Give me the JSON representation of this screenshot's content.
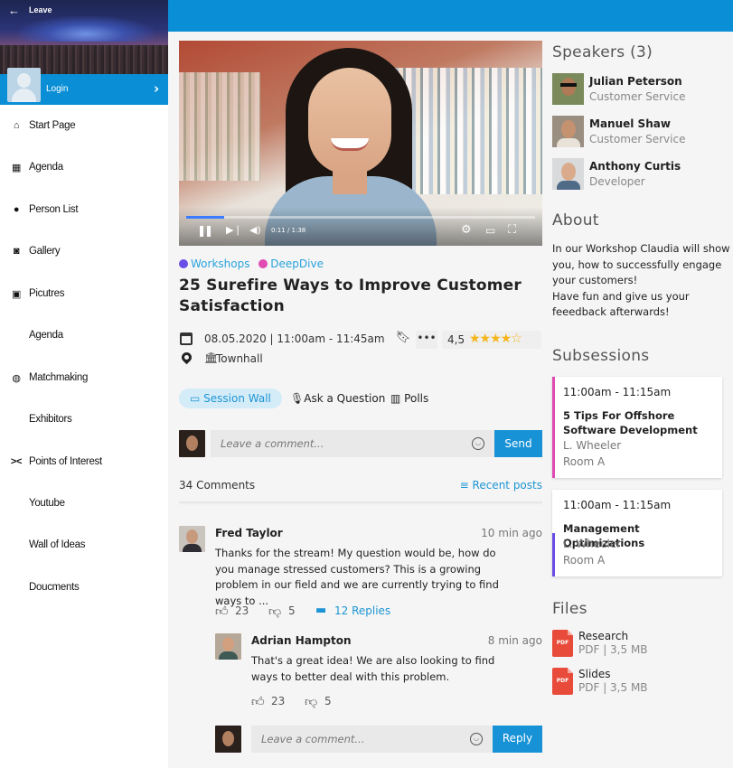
{
  "header": {
    "back_icon": "arrow-left-icon",
    "leave_label": "Leave"
  },
  "login": {
    "label": "Login"
  },
  "sidebar": {
    "items": [
      {
        "label": "Start Page",
        "icon": "home-icon"
      },
      {
        "label": "Agenda",
        "icon": "calendar-icon"
      },
      {
        "label": "Person List",
        "icon": "person-icon"
      },
      {
        "label": "Gallery",
        "icon": "camera-icon"
      },
      {
        "label": "Picutres",
        "icon": "image-icon"
      },
      {
        "label": "Agenda",
        "icon": ""
      },
      {
        "label": "Matchmaking",
        "icon": "globe-icon"
      },
      {
        "label": "Exhibitors",
        "icon": ""
      },
      {
        "label": "Points of Interest",
        "icon": "shrink-arrows-icon"
      },
      {
        "label": "Youtube",
        "icon": ""
      },
      {
        "label": "Wall of Ideas",
        "icon": ""
      },
      {
        "label": "Doucments",
        "icon": ""
      }
    ]
  },
  "video": {
    "time": "0:11 / 1:38",
    "progress": 0.11
  },
  "session": {
    "tags": [
      {
        "label": "Workshops",
        "color": "#6a4ee6"
      },
      {
        "label": "DeepDive",
        "color": "#e04ab1"
      }
    ],
    "title": "25 Surefire Ways to Improve Customer Satisfaction",
    "date": "08.05.2020 | 11:00am - 11:45am",
    "location": "Townhall",
    "rating": "4,5",
    "stars": "★★★★☆"
  },
  "tabs": [
    {
      "label": "Session Wall",
      "icon": "chat-icon"
    },
    {
      "label": "Ask a Question",
      "icon": "microphone-icon"
    },
    {
      "label": "Polls",
      "icon": "bar-chart-icon"
    }
  ],
  "comment_box": {
    "placeholder": "Leave a comment...",
    "send_label": "Send"
  },
  "comments_header": {
    "count": "34 Comments",
    "sort_label": "Recent posts"
  },
  "comments": [
    {
      "author": "Fred Taylor",
      "time": "10 min ago",
      "text": "Thanks for the stream! My question would be, how do you manage stressed customers? This is a growing problem in our field and we are currently trying to find ways to ...",
      "likes": "23",
      "dislikes": "5",
      "replies": "12 Replies",
      "reply": {
        "author": "Adrian Hampton",
        "time": "8 min ago",
        "text": "That's a great idea! We are also looking to find ways to better deal with this problem.",
        "likes": "23",
        "dislikes": "5"
      }
    }
  ],
  "reply_box": {
    "placeholder": "Leave a comment...",
    "reply_label": "Reply"
  },
  "speakers": {
    "title": "Speakers (3)",
    "list": [
      {
        "name": "Julian Peterson",
        "role": "Customer Service"
      },
      {
        "name": "Manuel Shaw",
        "role": "Customer Service"
      },
      {
        "name": "Anthony Curtis",
        "role": "Developer"
      }
    ]
  },
  "about": {
    "title": "About",
    "text": "In our Workshop Claudia will show you, how to successfully engage your customers!\nHave fun and give us your feeedback afterwards!"
  },
  "subsessions": {
    "title": "Subsessions",
    "list": [
      {
        "time": "11:00am - 11:15am",
        "name": "5 Tips For Offshore Software Development",
        "speaker": "L. Wheeler",
        "room": "Room A",
        "color": "#e04ab1"
      },
      {
        "time": "11:00am - 11:15am",
        "name": "Management Optimizations",
        "speaker": "L. Wheeler",
        "room": "Room A",
        "color": "#6a4ee6"
      }
    ]
  },
  "files": {
    "title": "Files",
    "list": [
      {
        "name": "Research",
        "meta": "PDF | 3,5 MB"
      },
      {
        "name": "Slides",
        "meta": "PDF | 3,5 MB"
      }
    ]
  }
}
